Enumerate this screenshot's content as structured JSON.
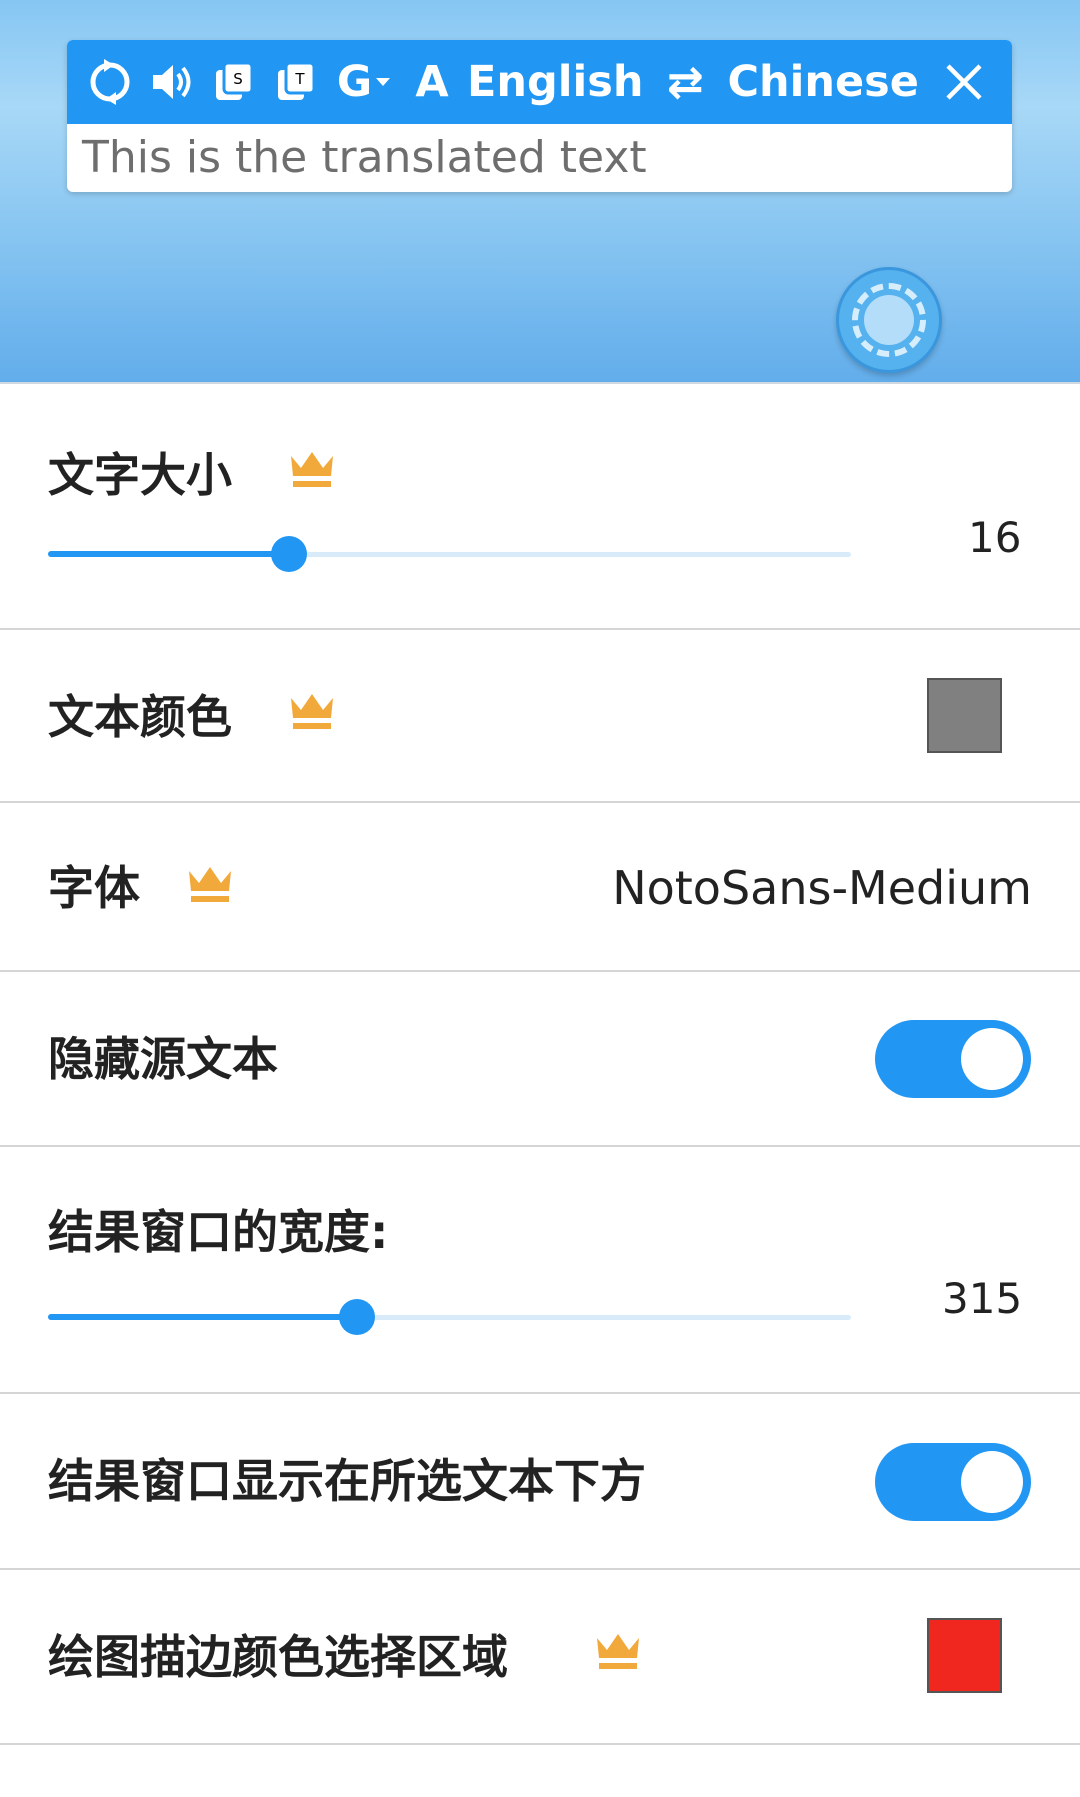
{
  "preview": {
    "toolbar": {
      "icons": [
        "refresh-icon",
        "speaker-icon",
        "s-copy-icon",
        "t-copy-icon",
        "google-translate-icon",
        "font-size-icon",
        "swap-icon",
        "close-icon"
      ],
      "g_label": "G",
      "a_label": "A",
      "source_lang": "English",
      "swap_glyph": "⇄",
      "target_lang": "Chinese"
    },
    "translated_text": "This is the translated text"
  },
  "settings": {
    "text_size": {
      "label": "文字大小",
      "value": "16",
      "fraction": 0.3,
      "premium": true
    },
    "text_color": {
      "label": "文本颜色",
      "color": "#808080",
      "premium": true
    },
    "font": {
      "label": "字体",
      "value": "NotoSans-Medium",
      "premium": true
    },
    "hide_source": {
      "label": "隐藏源文本",
      "on": true
    },
    "result_width": {
      "label": "结果窗口的宽度:",
      "value": "315",
      "fraction": 0.385
    },
    "show_below": {
      "label": "结果窗口显示在所选文本下方",
      "on": true
    },
    "stroke_color": {
      "label": "绘图描边颜色选择区域",
      "color": "#f0271e",
      "premium": true
    }
  },
  "colors": {
    "accent": "#2196f3",
    "crown": "#f2a93b",
    "header_bg": "#86c6f3"
  }
}
